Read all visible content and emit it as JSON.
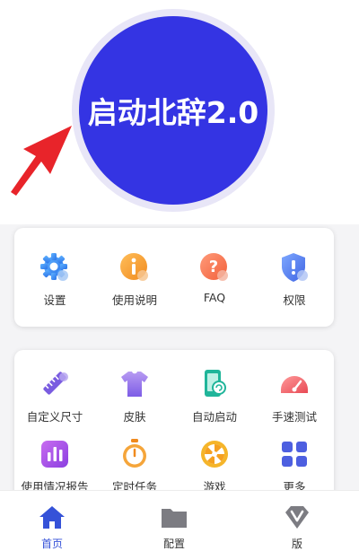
{
  "launch": {
    "label": "启动北辞2.0",
    "color": "#3434e3"
  },
  "menu_primary": [
    {
      "label": "设置",
      "icon": "gear-icon"
    },
    {
      "label": "使用说明",
      "icon": "info-icon"
    },
    {
      "label": "FAQ",
      "icon": "question-icon"
    },
    {
      "label": "权限",
      "icon": "shield-icon"
    }
  ],
  "menu_tools": [
    {
      "label": "自定义尺寸",
      "icon": "ruler-pencil-icon"
    },
    {
      "label": "皮肤",
      "icon": "tshirt-icon"
    },
    {
      "label": "自动启动",
      "icon": "phone-auto-icon"
    },
    {
      "label": "手速测试",
      "icon": "speedometer-icon"
    },
    {
      "label": "使用情况报告",
      "icon": "bar-chart-icon"
    },
    {
      "label": "定时任务",
      "icon": "stopwatch-icon"
    },
    {
      "label": "游戏",
      "icon": "wheel-icon"
    },
    {
      "label": "更多",
      "icon": "grid-icon"
    }
  ],
  "bottom_nav": [
    {
      "label": "首页",
      "icon": "home-icon",
      "active": true
    },
    {
      "label": "配置",
      "icon": "folder-icon",
      "active": false
    },
    {
      "label": "版",
      "icon": "v-badge-icon",
      "active": false
    }
  ],
  "colors": {
    "accent": "#3552d8",
    "arrow": "#e8242a"
  }
}
